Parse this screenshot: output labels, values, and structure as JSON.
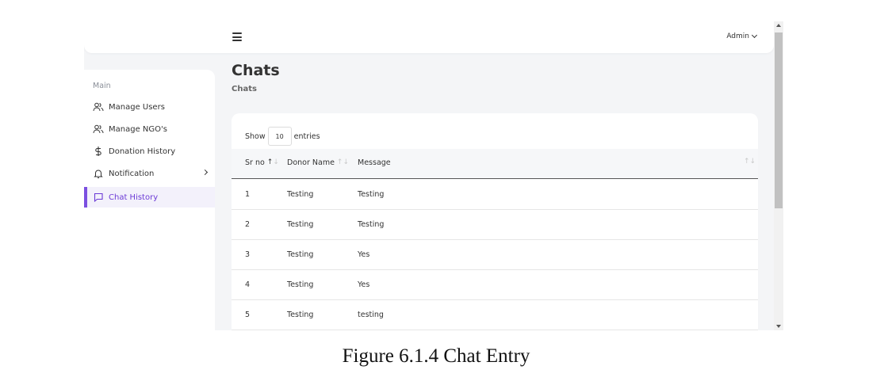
{
  "header": {
    "user_label": "Admin",
    "menu_icon": "hamburger-icon",
    "dropdown_icon": "chevron-down-icon"
  },
  "sidebar": {
    "section_label": "Main",
    "items": [
      {
        "label": "Manage Users",
        "icon": "users-icon"
      },
      {
        "label": "Manage NGO's",
        "icon": "users-icon"
      },
      {
        "label": "Donation History",
        "icon": "dollar-icon"
      },
      {
        "label": "Notification",
        "icon": "bell-icon"
      },
      {
        "label": "Chat History",
        "icon": "chat-icon",
        "active": true
      }
    ],
    "accent_color": "#7b4fe0"
  },
  "page": {
    "title": "Chats",
    "breadcrumb": "Chats"
  },
  "table": {
    "show_label": "Show",
    "entries_value": "10",
    "entries_label": "entries",
    "columns": [
      "Sr no",
      "Donor Name",
      "Message"
    ],
    "rows": [
      [
        "1",
        "Testing",
        "Testing"
      ],
      [
        "2",
        "Testing",
        "Testing"
      ],
      [
        "3",
        "Testing",
        "Yes"
      ],
      [
        "4",
        "Testing",
        "Yes"
      ],
      [
        "5",
        "Testing",
        "testing"
      ]
    ]
  },
  "caption": "Figure  6.1.4 Chat Entry"
}
